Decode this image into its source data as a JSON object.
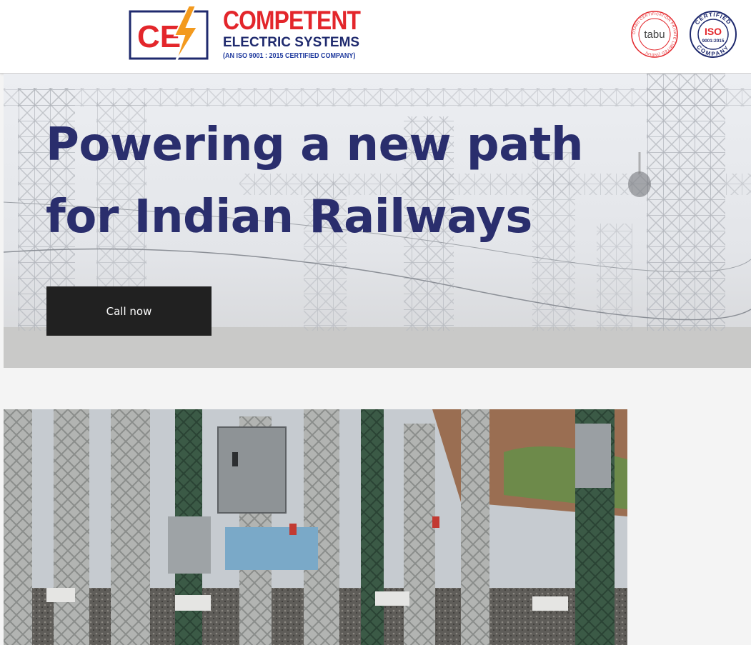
{
  "header": {
    "logo": {
      "mark_text": "CE",
      "title": "COMPETENT",
      "subtitle": "ELECTRIC SYSTEMS",
      "certification": "(AN ISO 9001 : 2015 CERTIFIED COMPANY)",
      "icon": "lightning-bolt-icon",
      "colors": {
        "red": "#e3262b",
        "navy": "#1f2a6e",
        "orange": "#f39a1e"
      }
    },
    "badges": {
      "tabu": {
        "center_text": "tabu",
        "ring_text": "OTABU CERTIFICATION PRIVATE LIMITED (INDIA)"
      },
      "iso": {
        "top_text": "CERTIFIED",
        "center_text": "ISO",
        "number": "9001:2015",
        "bottom_text": "COMPANY"
      }
    }
  },
  "hero": {
    "title_line1": "Powering a new path",
    "title_line2": "for Indian Railways",
    "cta_label": "Call now",
    "title_color": "#2a2e6d",
    "background": "electrical-gantry-photo"
  },
  "gallery": {
    "image": "electrical-substation-photo"
  }
}
